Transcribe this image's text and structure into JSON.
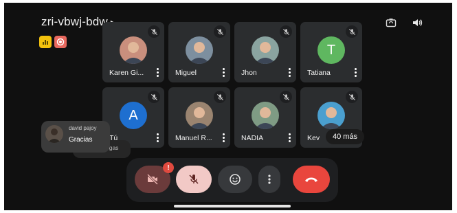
{
  "meeting": {
    "code": "zri-vbwj-bdw",
    "arrow": "▸"
  },
  "participants": [
    {
      "name": "Karen Gi...",
      "kind": "photo",
      "bg": "#c98f7d"
    },
    {
      "name": "Miguel",
      "kind": "photo",
      "bg": "#7d8f9f"
    },
    {
      "name": "Jhon",
      "kind": "photo",
      "bg": "#8aa4a0"
    },
    {
      "name": "Tatiana",
      "kind": "letter",
      "letter": "T",
      "bg": "#5fb760"
    },
    {
      "name": "Tú",
      "kind": "letter",
      "letter": "A",
      "bg": "#1e6fd0"
    },
    {
      "name": "Manuel R...",
      "kind": "photo",
      "bg": "#9a8470"
    },
    {
      "name": "NADIA",
      "kind": "photo",
      "bg": "#7f9b84"
    },
    {
      "name": "Kev",
      "kind": "photo",
      "bg": "#4a9fcf"
    }
  ],
  "more_participants": "40 más",
  "chat": {
    "sender": "david pajoy",
    "message": "Gracias",
    "other_text": "egas"
  },
  "controls": {
    "alert_badge": "!"
  },
  "colors": {
    "end_call": "#e9463d",
    "mic_muted": "#f2c9c6",
    "camera_off": "#6b3b3b"
  }
}
